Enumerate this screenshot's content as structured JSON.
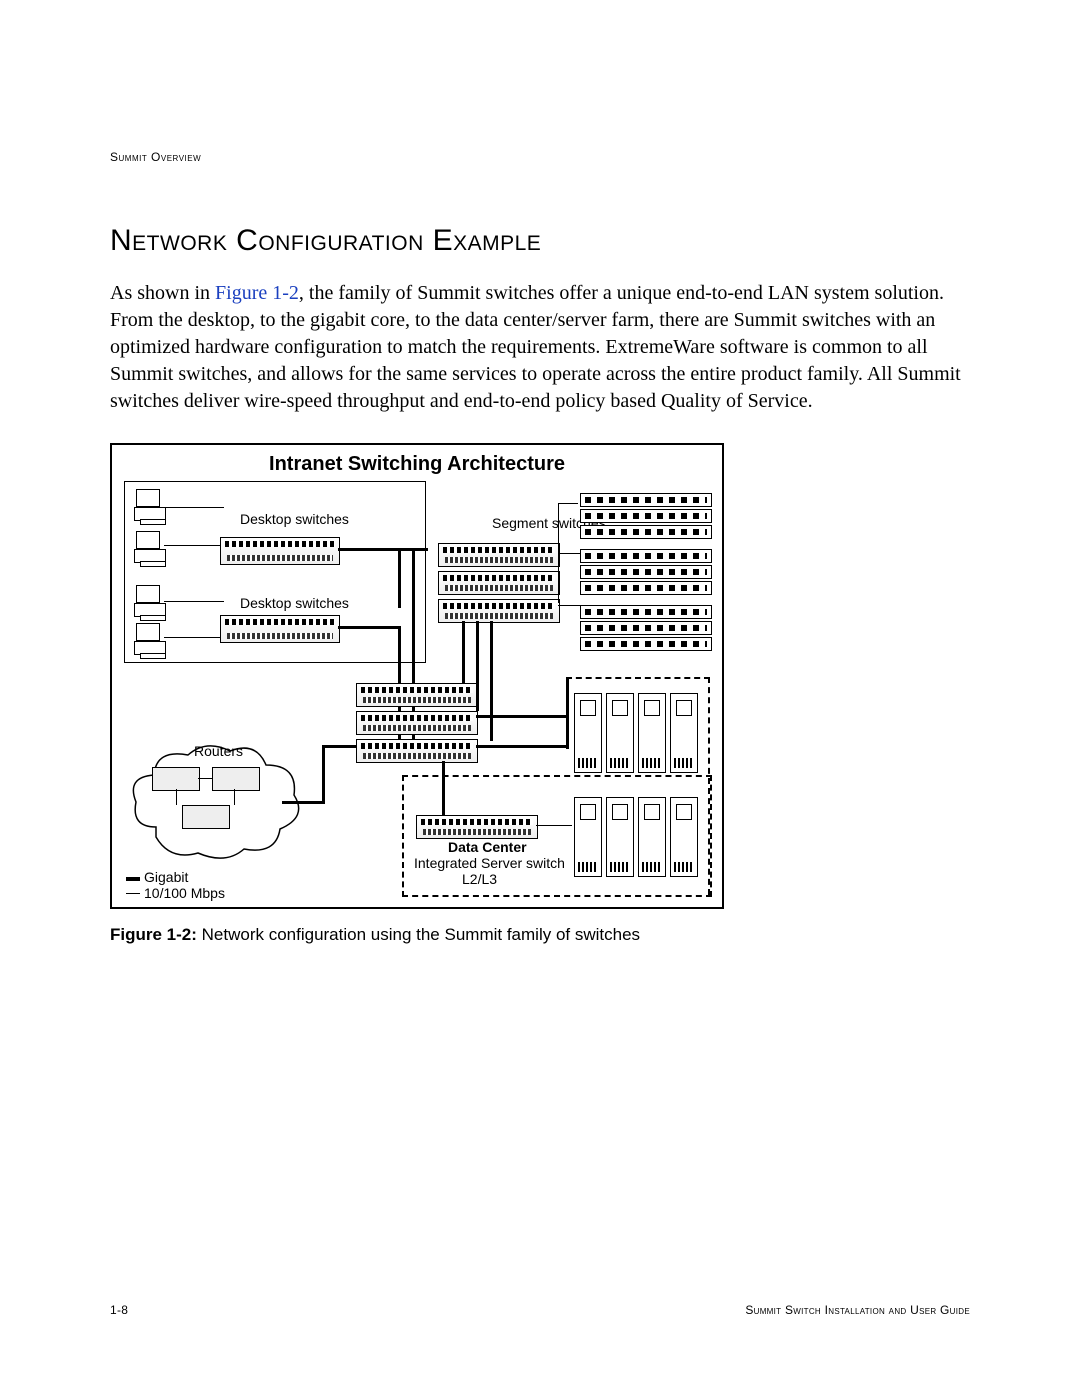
{
  "header": {
    "running": "Summit Overview"
  },
  "section": {
    "title": "Network Configuration Example"
  },
  "paragraph": {
    "lead": "As shown in ",
    "figref": "Figure 1-2",
    "rest": ", the family of Summit switches offer a unique end-to-end LAN system solution. From the desktop, to the gigabit core, to the data center/server farm, there are Summit switches with an optimized hardware configuration to match the requirements. ExtremeWare software is common to all Summit switches, and allows for the same services to operate across the entire product family. All Summit switches deliver wire-speed throughput and end-to-end policy based Quality of Service."
  },
  "figure": {
    "title": "Intranet Switching Architecture",
    "labels": {
      "desktop1": "Desktop switches",
      "desktop2": "Desktop switches",
      "segment": "Segment switches",
      "routers": "Routers",
      "datacenter_title": "Data Center",
      "datacenter_sub1": "Integrated Server switch",
      "datacenter_sub2": "L2/L3",
      "legend_gigabit": "Gigabit",
      "legend_10_100": "10/100 Mbps"
    },
    "caption_strong": "Figure 1-2:",
    "caption_rest": " Network configuration using the Summit family of switches"
  },
  "footer": {
    "left": "1-8",
    "right": "Summit Switch Installation and User Guide"
  }
}
